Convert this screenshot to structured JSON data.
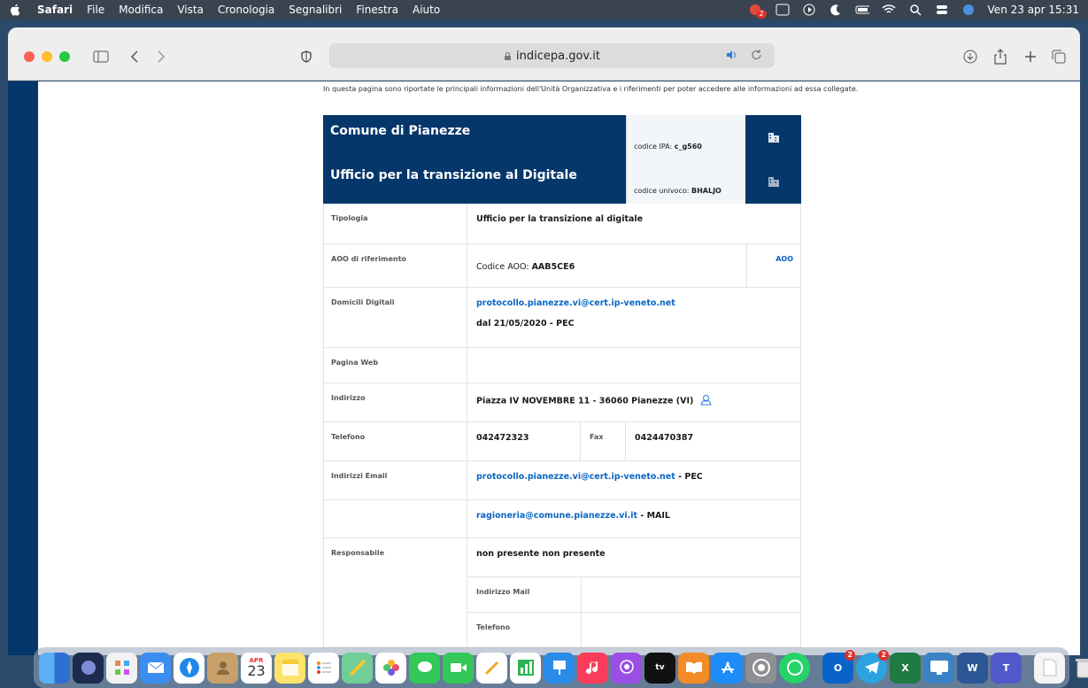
{
  "menubar": {
    "items": [
      "Safari",
      "File",
      "Modifica",
      "Vista",
      "Cronologia",
      "Segnalibri",
      "Finestra",
      "Aiuto"
    ],
    "clock": "Ven 23 apr 15:31",
    "badge": "2"
  },
  "browser": {
    "url": "indicepa.gov.it"
  },
  "page": {
    "intro": "In questa pagina sono riportate le principali informazioni dell'Unità Organizzativa e i riferimenti per poter accedere alle informazioni ad essa collegate.",
    "entity": {
      "title": "Comune di Pianezze",
      "code_label": "codice IPA:",
      "code": "c_g560"
    },
    "office": {
      "title": "Ufficio per la transizione al Digitale",
      "code_label": "codice univoco:",
      "code": "BHALJO"
    },
    "rows": {
      "tipologia": {
        "label": "Tipologia",
        "value": "Ufficio per la transizione al digitale"
      },
      "aoo": {
        "label": "AOO di riferimento",
        "prefix": "Codice AOO:",
        "code": "AAB5CE6",
        "link": "AOO"
      },
      "domicili": {
        "label": "Domicili Digitali",
        "email": "protocollo.pianezze.vi@cert.ip-veneto.net",
        "since": "dal 21/05/2020 - PEC"
      },
      "web": {
        "label": "Pagina Web",
        "value": ""
      },
      "indirizzo": {
        "label": "Indirizzo",
        "value": "Piazza IV NOVEMBRE 11 - 36060 Pianezze (VI)"
      },
      "telefono": {
        "label": "Telefono",
        "value": "042472323",
        "fax_label": "Fax",
        "fax": "0424470387"
      },
      "email": {
        "label": "Indirizzi Email",
        "pec": "protocollo.pianezze.vi@cert.ip-veneto.net",
        "pec_suffix": " - PEC",
        "mail": "ragioneria@comune.pianezze.vi.it",
        "mail_suffix": " - MAIL"
      },
      "responsabile": {
        "label": "Responsabile",
        "value": "non presente non presente",
        "mail_label": "Indirizzo Mail",
        "tel_label": "Telefono"
      }
    }
  },
  "dock": {
    "calendar_month": "APR",
    "calendar_day": "23",
    "apple_tv": "tv",
    "outlook_badge": "2",
    "telegram_badge": "2",
    "excel_letter": "X",
    "word_letter": "W",
    "teams_letter": "T",
    "outlook_letter": "O"
  }
}
